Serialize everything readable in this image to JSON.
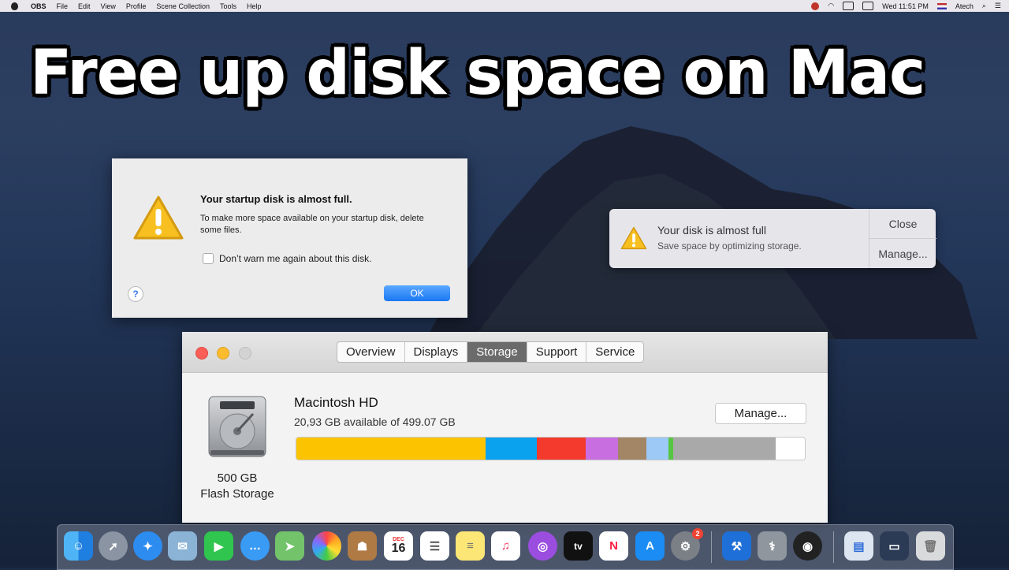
{
  "menubar": {
    "app": "OBS",
    "items": [
      "File",
      "Edit",
      "View",
      "Profile",
      "Scene Collection",
      "Tools",
      "Help"
    ],
    "clock": "Wed 11:51 PM",
    "user": "Atech"
  },
  "headline": "Free up disk space on Mac",
  "alert": {
    "title": "Your startup disk is almost full.",
    "message": "To make more space available on your startup disk, delete some files.",
    "checkbox_label": "Don’t warn me again about this disk.",
    "checkbox_checked": false,
    "ok_label": "OK",
    "help_label": "?"
  },
  "notification": {
    "title": "Your disk is almost full",
    "subtitle": "Save space by optimizing storage.",
    "close_label": "Close",
    "manage_label": "Manage..."
  },
  "about": {
    "tabs": [
      "Overview",
      "Displays",
      "Storage",
      "Support",
      "Service"
    ],
    "active_tab": "Storage",
    "disk_name": "Macintosh HD",
    "disk_available": "20,93 GB  available of 499.07 GB",
    "manage_label": "Manage...",
    "capacity": "500 GB",
    "storage_type": "Flash Storage",
    "storage_segments": [
      {
        "color": "#fcc400",
        "share": 0.372
      },
      {
        "color": "#0aa2ef",
        "share": 0.101
      },
      {
        "color": "#f33a2c",
        "share": 0.096
      },
      {
        "color": "#c86ee0",
        "share": 0.064
      },
      {
        "color": "#a38665",
        "share": 0.056
      },
      {
        "color": "#9dc9f6",
        "share": 0.043
      },
      {
        "color": "#56c541",
        "share": 0.009
      },
      {
        "color": "#a9a9a9",
        "share": 0.201
      },
      {
        "color": "#ffffff",
        "share": 0.058
      }
    ]
  },
  "dock": {
    "calendar_month": "DEC",
    "calendar_day": "16",
    "updates_badge": "2",
    "tv_label": "tv"
  }
}
